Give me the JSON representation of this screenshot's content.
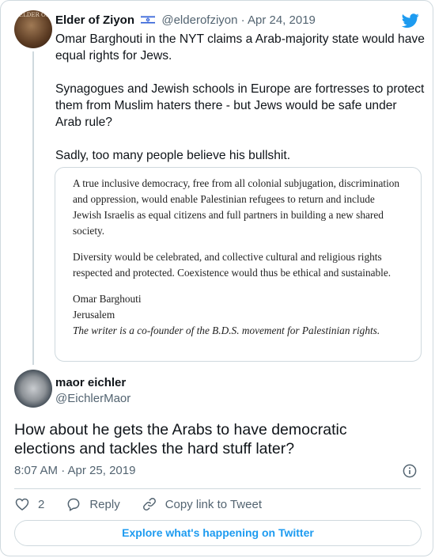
{
  "parent_tweet": {
    "author_name": "Elder of Ziyon",
    "avatar_label": "ELDER OF",
    "handle": "@elderofziyon",
    "separator": "·",
    "date": "Apr 24, 2019",
    "paragraphs": [
      "Omar Barghouti in the NYT claims a Arab-majority state would have equal rights for Jews.",
      "Synagogues and Jewish schools in Europe are fortresses to protect them from Muslim haters there - but Jews would be safe under Arab rule?",
      "Sadly, too many people believe his bullshit."
    ]
  },
  "quoted_image": {
    "paragraph1": "A true inclusive democracy, free from all colonial subjugation, discrimination and oppression, would enable Palestinian refugees to return and include Jewish Israelis as equal citizens and full partners in building a new shared society.",
    "paragraph2": "Diversity would be celebrated, and collective cultural and religious rights respected and protected. Coexistence would thus be ethical and sustainable.",
    "signature_name": "Omar Barghouti",
    "signature_place": "Jerusalem",
    "caption": "The writer is a co-founder of the B.D.S. movement for Palestinian rights."
  },
  "reply_tweet": {
    "author_name": "maor eichler",
    "handle": "@EichlerMaor",
    "text": "How about he gets the Arabs to have democratic elections and tackles the hard stuff later?",
    "timestamp": "8:07 AM · Apr 25, 2019"
  },
  "actions": {
    "like_count": "2",
    "reply_label": "Reply",
    "copy_link_label": "Copy link to Tweet"
  },
  "explore_label": "Explore what's happening on Twitter",
  "colors": {
    "accent": "#1d9bf0",
    "muted": "#536471",
    "border": "#cfd9de"
  },
  "icons": [
    "twitter-logo-icon",
    "israel-flag-icon",
    "info-icon",
    "heart-icon",
    "reply-icon",
    "link-icon"
  ]
}
